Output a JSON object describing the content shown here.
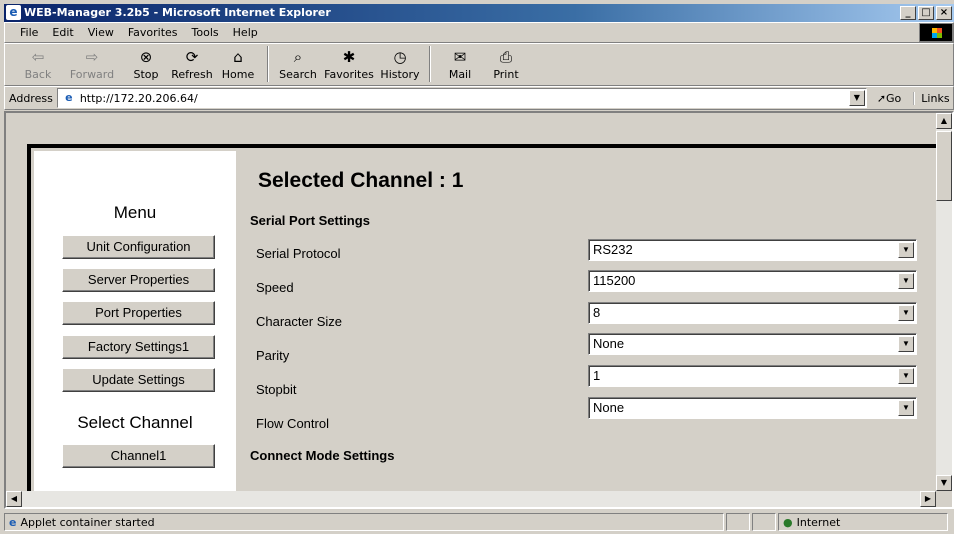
{
  "window": {
    "title": "WEB-Manager 3.2b5 - Microsoft Internet Explorer"
  },
  "menubar": [
    "File",
    "Edit",
    "View",
    "Favorites",
    "Tools",
    "Help"
  ],
  "toolbar": {
    "back": "Back",
    "forward": "Forward",
    "stop": "Stop",
    "refresh": "Refresh",
    "home": "Home",
    "search": "Search",
    "favorites": "Favorites",
    "history": "History",
    "mail": "Mail",
    "print": "Print"
  },
  "address": {
    "label": "Address",
    "url": "http://172.20.206.64/",
    "go": "Go",
    "links": "Links"
  },
  "applet": {
    "menu_title": "Menu",
    "menu_buttons": [
      "Unit Configuration",
      "Server Properties",
      "Port Properties",
      "Factory Settings1",
      "Update Settings"
    ],
    "select_channel": "Select Channel",
    "channel_buttons": [
      "Channel1"
    ],
    "heading": "Selected Channel : 1",
    "serial_section": "Serial Port Settings",
    "fields": [
      {
        "label": "Serial Protocol",
        "value": "RS232"
      },
      {
        "label": "Speed",
        "value": "115200"
      },
      {
        "label": "Character Size",
        "value": "8"
      },
      {
        "label": "Parity",
        "value": "None"
      },
      {
        "label": "Stopbit",
        "value": "1"
      },
      {
        "label": "Flow Control",
        "value": "None"
      }
    ],
    "connect_section": "Connect Mode Settings"
  },
  "status": {
    "text": "Applet container started",
    "zone": "Internet"
  }
}
